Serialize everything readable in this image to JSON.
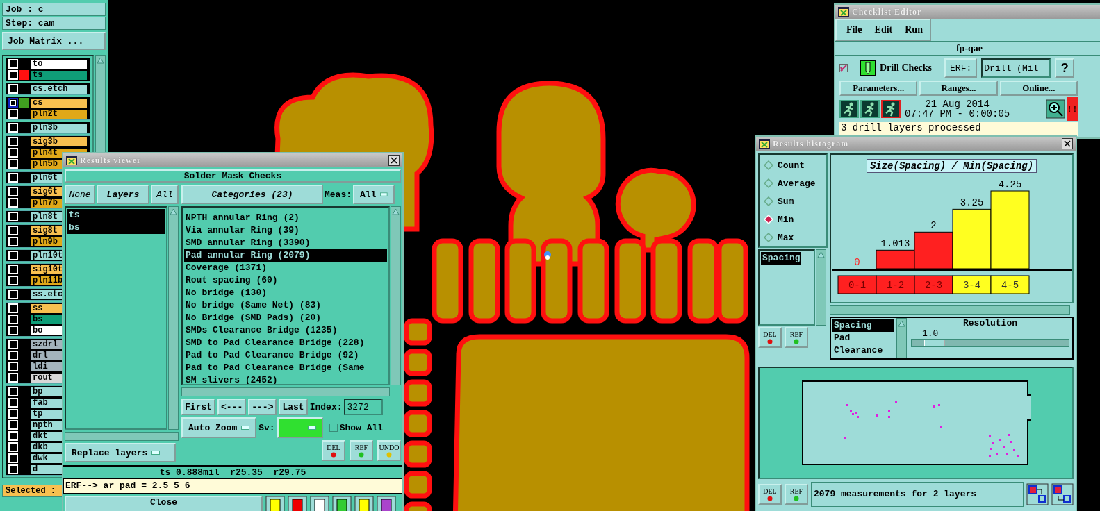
{
  "job_panel": {
    "job": "Job : c",
    "step": "Step: cam",
    "matrix_button": "Job Matrix ...",
    "selected_label": "Selected :",
    "groups": [
      [
        {
          "name": "to",
          "color": "#ffffff",
          "checked": false
        },
        {
          "name": "ts",
          "color": "#0f9e78",
          "marker": {
            "color": "#ff1010"
          },
          "checked": false
        }
      ],
      [
        {
          "name": "cs.etch",
          "color": "#9edcd8",
          "checked": false
        }
      ],
      [
        {
          "name": "cs",
          "color": "#f8c050",
          "marker": {
            "color": "#40a020"
          },
          "checked": true
        },
        {
          "name": "pln2t",
          "color": "#e0a818",
          "checked": false
        }
      ],
      [
        {
          "name": "pln3b",
          "color": "#9edcd8",
          "checked": false
        }
      ],
      [
        {
          "name": "sig3b",
          "color": "#f8c050",
          "checked": false
        },
        {
          "name": "pln4t",
          "color": "#e0a818",
          "checked": false
        },
        {
          "name": "pln5b",
          "color": "#e0a818",
          "checked": false
        }
      ],
      [
        {
          "name": "pln6t",
          "color": "#9edcd8",
          "checked": false
        }
      ],
      [
        {
          "name": "sig6t",
          "color": "#f8c050",
          "checked": false
        },
        {
          "name": "pln7b",
          "color": "#e0a818",
          "checked": false
        }
      ],
      [
        {
          "name": "pln8t",
          "color": "#9edcd8",
          "checked": false
        }
      ],
      [
        {
          "name": "sig8t",
          "color": "#f8c050",
          "checked": false
        },
        {
          "name": "pln9b",
          "color": "#e0a818",
          "checked": false
        }
      ],
      [
        {
          "name": "pln10t",
          "color": "#9edcd8",
          "checked": false
        }
      ],
      [
        {
          "name": "sig10t",
          "color": "#f8c050",
          "checked": false
        },
        {
          "name": "pln11b",
          "color": "#e0a818",
          "checked": false
        }
      ],
      [
        {
          "name": "ss.etc",
          "color": "#9edcd8",
          "checked": false
        }
      ],
      [
        {
          "name": "ss",
          "color": "#f8c050",
          "checked": false
        },
        {
          "name": "bs",
          "color": "#0f9e78",
          "checked": false
        },
        {
          "name": "bo",
          "color": "#ffffff",
          "checked": false
        }
      ],
      [
        {
          "name": "szdrl",
          "color": "#a4b4bc",
          "checked": false
        },
        {
          "name": "drl",
          "color": "#a4b4bc",
          "checked": false
        },
        {
          "name": "ldi",
          "color": "#a4b4bc",
          "checked": false
        },
        {
          "name": "rout",
          "color": "#d8d8d8",
          "checked": false
        }
      ],
      [
        {
          "name": "bp",
          "color": "#9edcd8",
          "checked": false
        },
        {
          "name": "fab",
          "color": "#9edcd8",
          "checked": false
        },
        {
          "name": "tp",
          "color": "#9edcd8",
          "checked": false
        },
        {
          "name": "npth",
          "color": "#9edcd8",
          "checked": false
        },
        {
          "name": "dkt",
          "color": "#9edcd8",
          "checked": false
        },
        {
          "name": "dkb",
          "color": "#9edcd8",
          "checked": false
        },
        {
          "name": "dwk",
          "color": "#9edcd8",
          "checked": false
        },
        {
          "name": "d",
          "color": "#9edcd8",
          "checked": false
        }
      ]
    ]
  },
  "results_viewer": {
    "title": "Results viewer",
    "header": "Solder Mask Checks",
    "none_button": "None",
    "layers_label": "Layers",
    "all_button": "All",
    "layers": [
      {
        "name": "ts",
        "selected": true
      },
      {
        "name": "bs",
        "selected": true
      }
    ],
    "categories_label": "Categories (23)",
    "meas_label": "Meas:",
    "meas_value": "All",
    "categories": [
      {
        "label": "NPTH annular Ring (2)",
        "selected": false
      },
      {
        "label": "Via annular Ring (39)",
        "selected": false
      },
      {
        "label": "SMD annular Ring (3390)",
        "selected": false
      },
      {
        "label": "Pad annular Ring (2079)",
        "selected": true
      },
      {
        "label": "Coverage (1371)",
        "selected": false
      },
      {
        "label": "Rout spacing (60)",
        "selected": false
      },
      {
        "label": "No bridge (130)",
        "selected": false
      },
      {
        "label": "No bridge (Same Net) (83)",
        "selected": false
      },
      {
        "label": "No Bridge (SMD Pads) (20)",
        "selected": false
      },
      {
        "label": "SMDs Clearance Bridge (1235)",
        "selected": false
      },
      {
        "label": "SMD to Pad Clearance Bridge (228)",
        "selected": false
      },
      {
        "label": "Pad to Pad Clearance Bridge (92)",
        "selected": false
      },
      {
        "label": "Pad to Pad Clearance Bridge (Same",
        "selected": false
      },
      {
        "label": "SM slivers (2452)",
        "selected": false
      }
    ],
    "nav_buttons": [
      "First",
      "<---",
      "--->",
      "Last"
    ],
    "index_label": "Index:",
    "index_value": "3272",
    "zoom_mode": "Auto Zoom",
    "sv_label": "Sv:",
    "show_all": {
      "label": "Show All",
      "checked": false
    },
    "replace_mode": "Replace layers",
    "action_buttons": [
      "DEL",
      "REF",
      "UNDO"
    ],
    "status": "ts 0.888mil  r25.35  r29.75",
    "erf_line": "ERF--> ar_pad = 2.5 5 6",
    "close_button": "Close"
  },
  "checklist_editor": {
    "title": "Checklist Editor",
    "menu": [
      "File",
      "Edit",
      "Run"
    ],
    "checklist": "fp-qae",
    "action": {
      "label": "Drill Checks",
      "checked": true
    },
    "erf_button": "ERF:",
    "erf_value": "Drill (Mil",
    "help_button": "?",
    "buttons": [
      "Parameters...",
      "Ranges...",
      "Online..."
    ],
    "date": "21 Aug 2014",
    "time": "07:47 PM - 0:00:05",
    "alert_button": "!!",
    "message": "3 drill layers processed"
  },
  "histogram": {
    "title": "Results histogram",
    "modes": [
      {
        "label": "Count",
        "selected": false
      },
      {
        "label": "Average",
        "selected": false
      },
      {
        "label": "Sum",
        "selected": false
      },
      {
        "label": "Min",
        "selected": true
      },
      {
        "label": "Max",
        "selected": false
      }
    ],
    "measures": [
      {
        "label": "Spacing",
        "selected": true
      }
    ],
    "chart_data": {
      "type": "bar",
      "title": "Size(Spacing) / Min(Spacing)",
      "categories": [
        "0-1",
        "1-2",
        "2-3",
        "3-4",
        "4-5"
      ],
      "series": [
        {
          "color": "#ff2020",
          "values": [
            0,
            1.013,
            2,
            null,
            null
          ]
        },
        {
          "color": "#ffff20",
          "values": [
            null,
            null,
            null,
            3.25,
            4.25
          ]
        }
      ],
      "data_labels": true
    },
    "value_labels": [
      "0",
      "1.013",
      "2",
      "3.25",
      "4.25"
    ],
    "fields": [
      {
        "label": "Spacing",
        "selected": true
      },
      {
        "label": "Pad",
        "selected": false
      },
      {
        "label": "Clearance",
        "selected": false
      }
    ],
    "resolution_label": "Resolution",
    "resolution_value": "1.0",
    "resolution": {
      "level": 0.08
    },
    "buttons": [
      "DEL",
      "REF"
    ],
    "bottom_buttons": [
      "DEL",
      "REF"
    ],
    "summary": "2079 measurements for 2 layers"
  }
}
